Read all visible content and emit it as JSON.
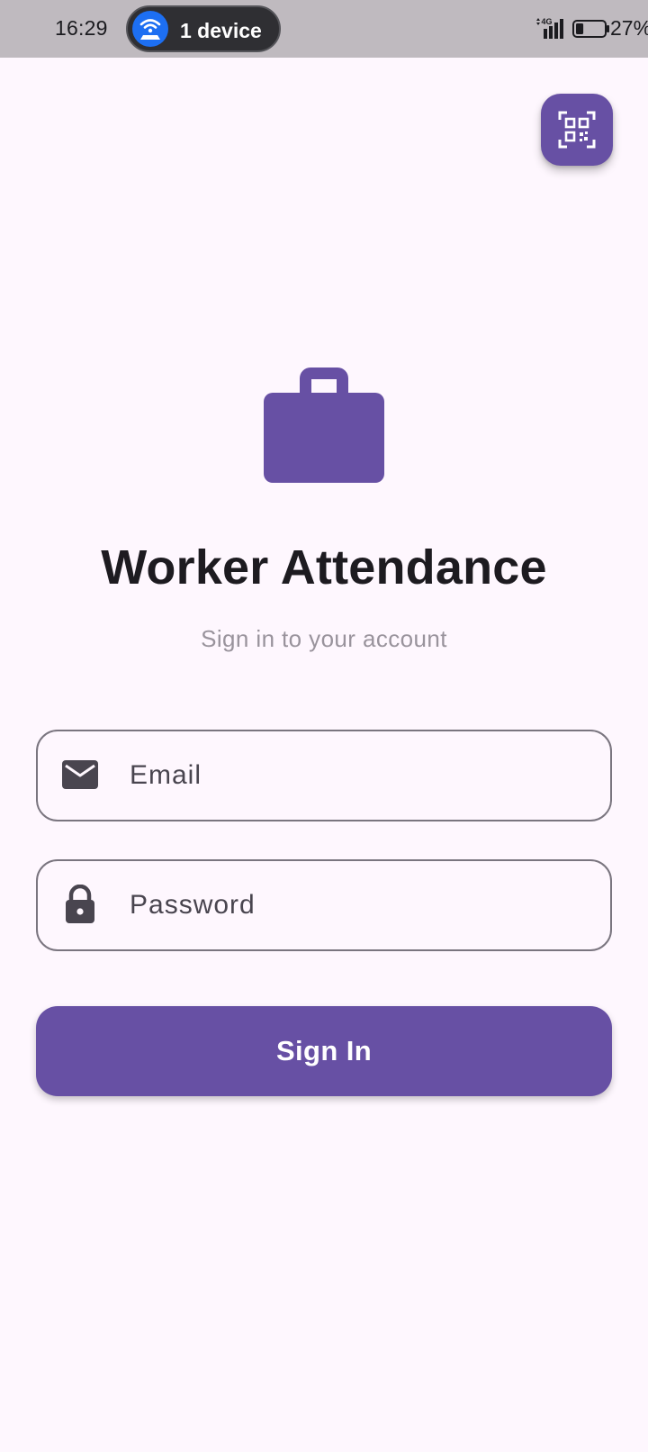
{
  "status_bar": {
    "time": "16:29",
    "device_label": "1 device",
    "network_type": "4G",
    "battery_percent": "27%",
    "battery_level": 0.27
  },
  "toolbar": {
    "qr_icon": "qr-code-scanner-icon"
  },
  "brand": {
    "icon": "briefcase-icon",
    "title": "Worker Attendance",
    "subtitle": "Sign in to your account"
  },
  "form": {
    "email": {
      "icon": "mail-icon",
      "placeholder": "Email",
      "value": ""
    },
    "password": {
      "icon": "lock-icon",
      "placeholder": "Password",
      "value": ""
    },
    "submit_label": "Sign In"
  },
  "colors": {
    "primary": "#6750a4",
    "background": "#fef7fe",
    "status_bar": "#bfbabf",
    "device_badge": "#1d6ff2"
  }
}
